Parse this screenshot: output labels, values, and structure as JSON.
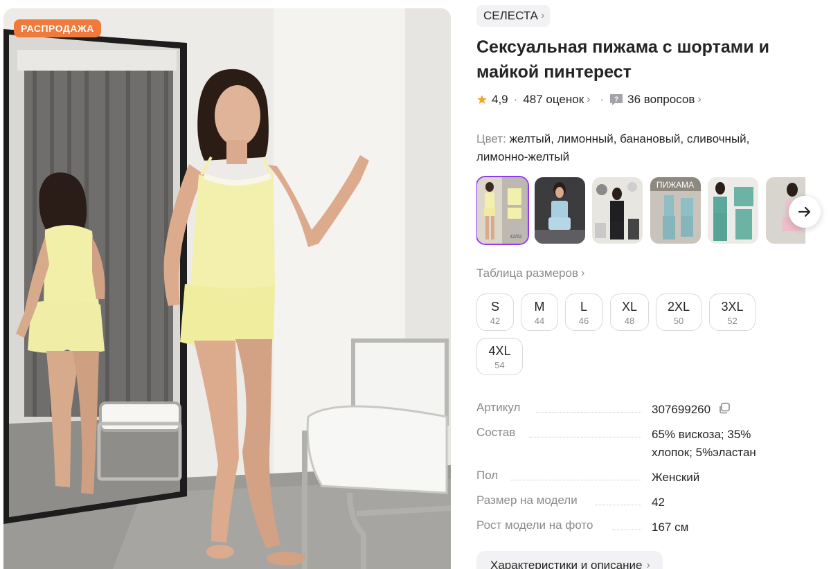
{
  "badge": "РАСПРОДАЖА",
  "brand": {
    "name": "СЕЛЕСТА"
  },
  "product": {
    "title": "Сексуальная пижама с шортами и майкой пинтерест"
  },
  "rating": {
    "score": "4,9",
    "reviews": "487 оценок",
    "questions": "36 вопросов"
  },
  "color": {
    "label": "Цвет:",
    "value": "желтый, лимонный, банановый, сливочный, лимонно-желтый"
  },
  "thumbnail_text": "ПИЖАМА",
  "thumbnail_size": "42/52",
  "size_table": "Таблица размеров",
  "sizes": [
    {
      "letter": "S",
      "num": "42"
    },
    {
      "letter": "M",
      "num": "44"
    },
    {
      "letter": "L",
      "num": "46"
    },
    {
      "letter": "XL",
      "num": "48"
    },
    {
      "letter": "2XL",
      "num": "50"
    },
    {
      "letter": "3XL",
      "num": "52"
    },
    {
      "letter": "4XL",
      "num": "54"
    }
  ],
  "specs": [
    {
      "key": "Артикул",
      "value": "307699260"
    },
    {
      "key": "Состав",
      "value": "65% вискоза; 35% хлопок; 5%эластан"
    },
    {
      "key": "Пол",
      "value": "Женский"
    },
    {
      "key": "Размер на модели",
      "value": "42"
    },
    {
      "key": "Рост модели на фото",
      "value": "167 см"
    }
  ],
  "description_button": "Характеристики и описание",
  "colors": {
    "badge": "#f07a3c",
    "selected": "#8e3bf0",
    "star": "#f5a623",
    "muted": "#8a8a8f"
  }
}
